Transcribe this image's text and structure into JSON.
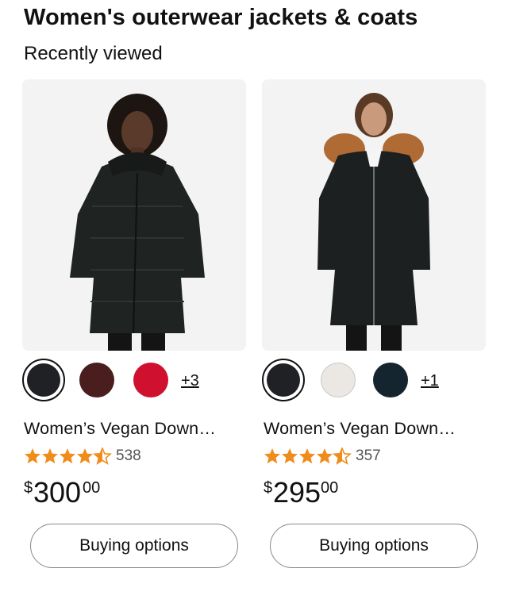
{
  "page": {
    "title": "Women's outerwear jackets & coats",
    "section": "Recently viewed"
  },
  "products": [
    {
      "title": "Women’s Vegan Down…",
      "rating": 4.5,
      "rating_count": "538",
      "price": {
        "symbol": "$",
        "whole": "300",
        "fraction": "00"
      },
      "swatches": [
        {
          "color": "#202124",
          "selected": true
        },
        {
          "color": "#4a1e1f",
          "selected": false
        },
        {
          "color": "#d0102f",
          "selected": false
        }
      ],
      "more_swatches": "+3",
      "button_label": "Buying options"
    },
    {
      "title": "Women’s Vegan Down…",
      "rating": 4.5,
      "rating_count": "357",
      "price": {
        "symbol": "$",
        "whole": "295",
        "fraction": "00"
      },
      "swatches": [
        {
          "color": "#202124",
          "selected": true
        },
        {
          "color": "#ebe7e2",
          "selected": false
        },
        {
          "color": "#15252f",
          "selected": false
        }
      ],
      "more_swatches": "+1",
      "button_label": "Buying options"
    }
  ],
  "colors": {
    "star": "#f08c1a",
    "image_bg": "#f3f3f3",
    "text": "#111111",
    "muted": "#555555"
  }
}
